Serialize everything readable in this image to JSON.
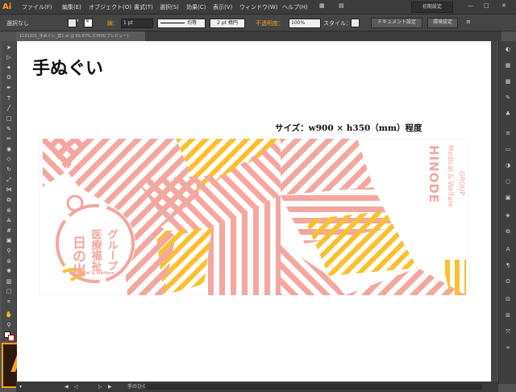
{
  "app": {
    "logo": "Ai",
    "big_logo": "Ai"
  },
  "menu": [
    {
      "label": "ファイル(F)"
    },
    {
      "label": "編集(E)"
    },
    {
      "label": "オブジェクト(O)"
    },
    {
      "label": "書式(T)"
    },
    {
      "label": "選択(S)"
    },
    {
      "label": "効果(C)"
    },
    {
      "label": "表示(V)"
    },
    {
      "label": "ウィンドウ(W)"
    },
    {
      "label": "ヘルプ(H)"
    }
  ],
  "workspace": "初期設定",
  "control": {
    "selection": "選択なし",
    "stroke_label": "線：",
    "stroke_value": "1 pt",
    "brush_label": "均等",
    "profile_label": "2 pt 楕円",
    "opacity_label": "不透明度：",
    "opacity_value": "100%",
    "style_label": "スタイル：",
    "doc_settings": "ドキュメント設定",
    "prefs": "環境設定"
  },
  "document": {
    "tab": "1101031_手ぬぐい_案1.ai @ 66.67% (CMYK/プレビュー)"
  },
  "canvas": {
    "title": "手ぬぐい",
    "size": "サイズ：w900 × h350（mm）程度"
  },
  "artwork": {
    "brand_en": "HINODE",
    "brand_sub1": "Medical & Welfare",
    "brand_sub2": "GROUP",
    "jp_line1": "日の出",
    "jp_line2": "医療福祉",
    "jp_line3": "グループ",
    "seal_en": "Medical & Welfare",
    "colors": {
      "pink": "#f3a7a0",
      "yellow": "#f9c12e"
    }
  },
  "status": {
    "artboard": "手のひら"
  },
  "icons": {
    "tools": [
      "selection-icon",
      "direct-selection-icon",
      "magic-wand-icon",
      "lasso-icon",
      "pen-icon",
      "type-icon",
      "line-icon",
      "rectangle-icon",
      "paintbrush-icon",
      "pencil-icon",
      "blob-brush-icon",
      "eraser-icon",
      "rotate-icon",
      "scale-icon",
      "width-icon",
      "free-transform-icon",
      "shape-builder-icon",
      "perspective-icon",
      "mesh-icon",
      "gradient-icon",
      "eyedropper-icon",
      "blend-icon",
      "symbol-sprayer-icon",
      "graph-icon",
      "artboard-icon",
      "slice-icon",
      "hand-icon",
      "zoom-icon"
    ],
    "panel": [
      "color-icon",
      "color-guide-icon",
      "swatches-icon",
      "brushes-icon",
      "symbols-icon",
      "stroke-icon",
      "gradient-panel-icon",
      "transparency-icon",
      "appearance-icon",
      "graphic-styles-icon",
      "layers-icon",
      "artboards-icon",
      "character-icon",
      "paragraph-icon",
      "opentype-icon",
      "align-icon",
      "pathfinder-icon",
      "transform-icon",
      "links-icon"
    ]
  }
}
